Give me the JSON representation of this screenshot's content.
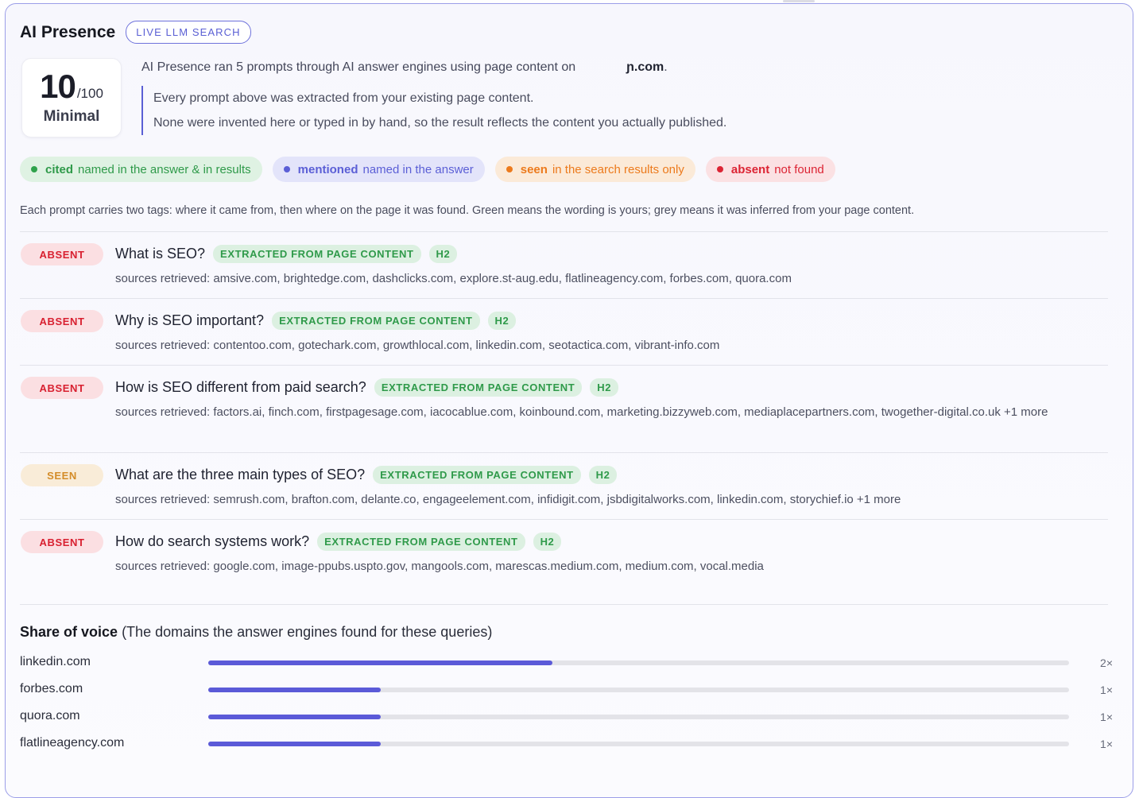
{
  "header": {
    "title": "AI Presence",
    "badge": "LIVE LLM SEARCH"
  },
  "score": {
    "value": "10",
    "denominator": "/100",
    "label": "Minimal"
  },
  "summary": {
    "text": "AI Presence ran 5 prompts through AI answer engines using page content on",
    "domain": "ɲ.com",
    "period": "."
  },
  "quote": {
    "line1": "Every prompt above was extracted from your existing page content.",
    "line2": "None were invented here or typed in by hand, so the result reflects the content you actually published."
  },
  "legend": [
    {
      "key": "cited",
      "desc": "named in the answer & in results",
      "color": "#2fa24c"
    },
    {
      "key": "mentioned",
      "desc": "named in the answer",
      "color": "#5b5fd6"
    },
    {
      "key": "seen",
      "desc": "in the search results only",
      "color": "#ec7a1c"
    },
    {
      "key": "absent",
      "desc": "not found",
      "color": "#dc2434"
    }
  ],
  "explain": "Each prompt carries two tags: where it came from, then where on the page it was found. Green means the wording is yours; grey means it was inferred from your page content.",
  "prompts": [
    {
      "status": "ABSENT",
      "question": "What is SEO?",
      "tag_source": "EXTRACTED FROM PAGE CONTENT",
      "tag_location": "H2",
      "sources": "sources retrieved: amsive.com, brightedge.com, dashclicks.com, explore.st-aug.edu, flatlineagency.com, forbes.com, quora.com"
    },
    {
      "status": "ABSENT",
      "question": "Why is SEO important?",
      "tag_source": "EXTRACTED FROM PAGE CONTENT",
      "tag_location": "H2",
      "sources": "sources retrieved: contentoo.com, gotechark.com, growthlocal.com, linkedin.com, seotactica.com, vibrant-info.com"
    },
    {
      "status": "ABSENT",
      "question": "How is SEO different from paid search?",
      "tag_source": "EXTRACTED FROM PAGE CONTENT",
      "tag_location": "H2",
      "sources": "sources retrieved: factors.ai, finch.com, firstpagesage.com, iacocablue.com, koinbound.com, marketing.bizzyweb.com, mediaplacepartners.com, twogether-digital.co.uk +1 more"
    },
    {
      "status": "SEEN",
      "question": "What are the three main types of SEO?",
      "tag_source": "EXTRACTED FROM PAGE CONTENT",
      "tag_location": "H2",
      "sources": "sources retrieved: semrush.com, brafton.com, delante.co, engageelement.com, infidigit.com, jsbdigitalworks.com, linkedin.com, storychief.io +1 more"
    },
    {
      "status": "ABSENT",
      "question": "How do search systems work?",
      "tag_source": "EXTRACTED FROM PAGE CONTENT",
      "tag_location": "H2",
      "sources": "sources retrieved: google.com, image-ppubs.uspto.gov, mangools.com, marescas.medium.com, medium.com, vocal.media"
    }
  ],
  "share_of_voice": {
    "title": "Share of voice",
    "subtitle": "(The domains the answer engines found for these queries)",
    "max": 5,
    "items": [
      {
        "domain": "linkedin.com",
        "count": 2,
        "label": "2×"
      },
      {
        "domain": "forbes.com",
        "count": 1,
        "label": "1×"
      },
      {
        "domain": "quora.com",
        "count": 1,
        "label": "1×"
      },
      {
        "domain": "flatlineagency.com",
        "count": 1,
        "label": "1×"
      }
    ]
  }
}
